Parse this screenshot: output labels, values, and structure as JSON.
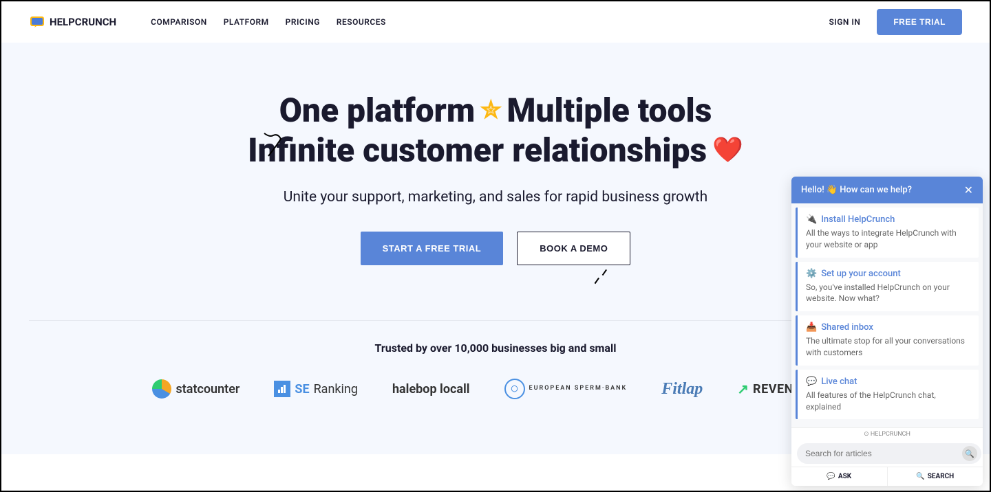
{
  "brand": "HELPCRUNCH",
  "nav": {
    "items": [
      "COMPARISON",
      "PLATFORM",
      "PRICING",
      "RESOURCES"
    ]
  },
  "header": {
    "signIn": "SIGN IN",
    "freeTrial": "FREE TRIAL"
  },
  "hero": {
    "titleLine1a": "One platform",
    "titleLine1b": "Multiple tools",
    "titleLine2": "Infinite customer relationships",
    "subtitle": "Unite your support, marketing, and sales for rapid business growth",
    "cta1": "START A FREE TRIAL",
    "cta2": "BOOK A DEMO"
  },
  "trusted": {
    "title": "Trusted by over 10,000 businesses big and small",
    "logos": {
      "statcounter": "statcounter",
      "seranking": "SE Ranking",
      "halebop": "halebop locall",
      "espermbank": "EUROPEAN SPERM·BANK",
      "fitlap": "Fitlap",
      "revenuegrid": "REVENUEGRID"
    }
  },
  "chat": {
    "header": "Hello! 👋 How can we help?",
    "brand": "HELPCRUNCH",
    "searchPlaceholder": "Search for articles",
    "tabAsk": "ASK",
    "tabSearch": "SEARCH",
    "cards": [
      {
        "icon": "🔌",
        "title": "Install HelpCrunch",
        "desc": "All the ways to integrate HelpCrunch with your website or app"
      },
      {
        "icon": "⚙️",
        "title": "Set up your account",
        "desc": "So, you've installed HelpCrunch on your website. Now what?"
      },
      {
        "icon": "📥",
        "title": "Shared inbox",
        "desc": "The ultimate stop for all your conversations with customers"
      },
      {
        "icon": "💬",
        "title": "Live chat",
        "desc": "All features of the HelpCrunch chat, explained"
      }
    ]
  }
}
